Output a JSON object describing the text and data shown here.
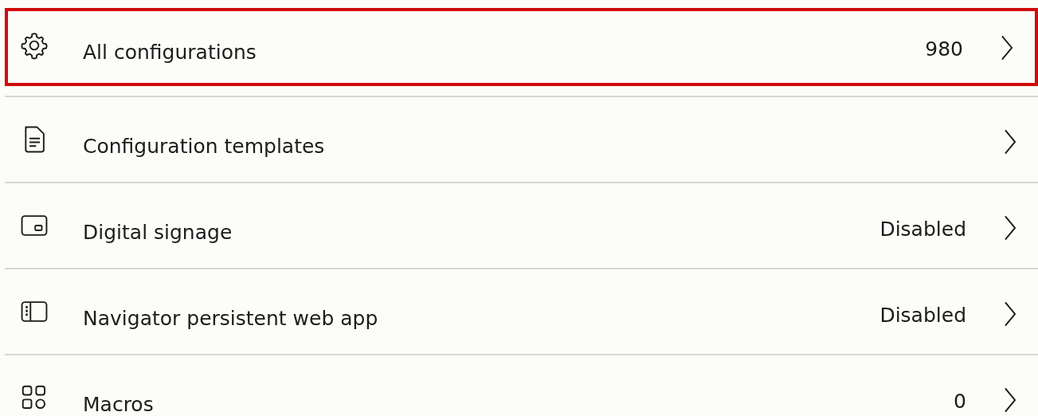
{
  "items": [
    {
      "kind": "gear",
      "label": "All configurations",
      "value": "980",
      "selected": true
    },
    {
      "kind": "document",
      "label": "Configuration templates",
      "selected": false
    },
    {
      "kind": "signage",
      "label": "Digital signage",
      "value": "Disabled",
      "selected": false
    },
    {
      "kind": "panel",
      "label": "Navigator persistent web app",
      "value": "Disabled",
      "selected": false
    },
    {
      "kind": "grid",
      "label": "Macros",
      "value": "0",
      "selected": false
    }
  ]
}
